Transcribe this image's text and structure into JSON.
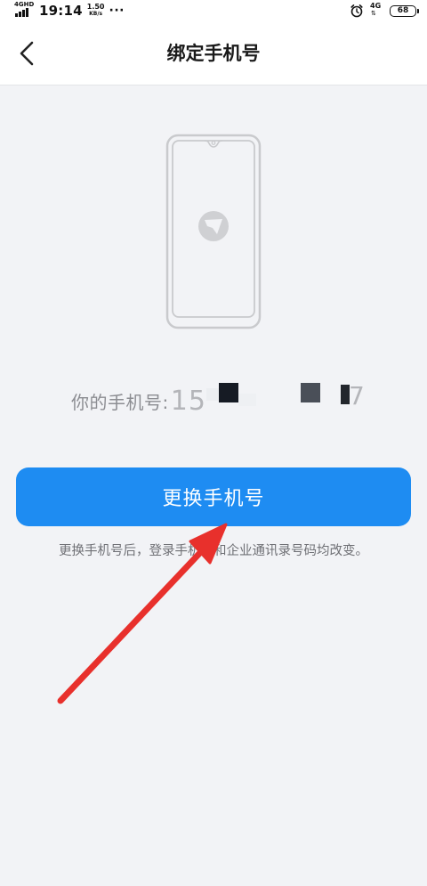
{
  "status_bar": {
    "network_type": "4GHD",
    "time": "19:14",
    "speed_value": "1.50",
    "speed_unit": "KB/s",
    "more": "···",
    "data_type": "4G",
    "battery_level": "68",
    "icons": [
      "signal-icon",
      "alarm-icon",
      "data-arrows-icon",
      "battery-icon"
    ]
  },
  "nav": {
    "title": "绑定手机号",
    "back_icon": "chevron-left-icon"
  },
  "illustration": {
    "icon": "phone-with-logo-icon"
  },
  "phone": {
    "label": "你的手机号:",
    "value": "15",
    "value_tail": "7"
  },
  "button": {
    "label": "更换手机号"
  },
  "hint": "更换手机号后，登录手机号和企业通讯录号码均改变。",
  "colors": {
    "primary": "#1e8cf2",
    "background": "#f2f3f6",
    "annotation": "#e8302c"
  }
}
